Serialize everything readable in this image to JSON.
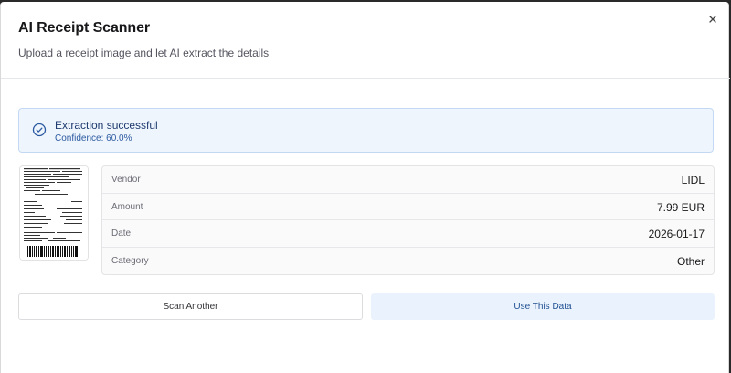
{
  "dialog": {
    "title": "AI Receipt Scanner",
    "subtitle": "Upload a receipt image and let AI extract the details",
    "close_icon": "close-icon"
  },
  "alert": {
    "icon": "check-circle-icon",
    "title": "Extraction successful",
    "confidence": "Confidence: 60.0%",
    "color": "#2c5aa0"
  },
  "receipt": {
    "thumbnail_icon": "receipt-image"
  },
  "details": [
    {
      "label": "Vendor",
      "value": "LIDL"
    },
    {
      "label": "Amount",
      "value": "7.99 EUR"
    },
    {
      "label": "Date",
      "value": "2026-01-17"
    },
    {
      "label": "Category",
      "value": "Other"
    }
  ],
  "actions": {
    "scan_another": "Scan Another",
    "use_data": "Use This Data"
  }
}
